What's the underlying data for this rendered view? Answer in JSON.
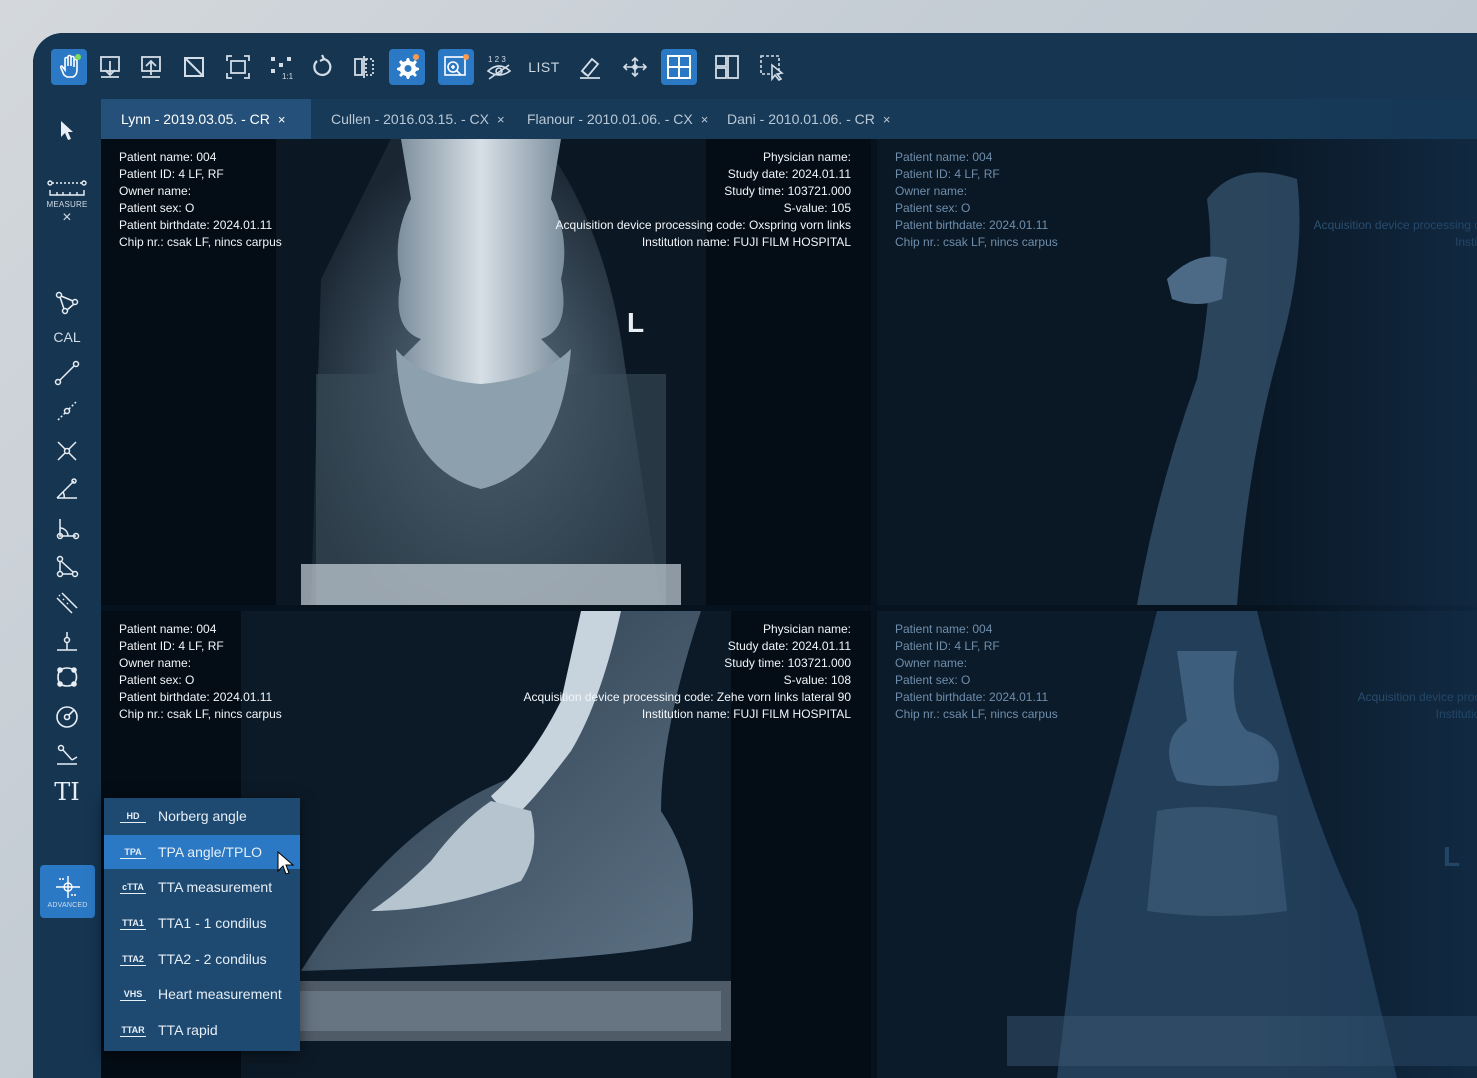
{
  "toolbar": {
    "buttons": [
      {
        "name": "hand-pan-icon",
        "active": true
      },
      {
        "name": "import-series-icon",
        "active": false
      },
      {
        "name": "export-series-icon",
        "active": false
      },
      {
        "name": "crop-icon",
        "active": false
      },
      {
        "name": "fit-to-screen-icon",
        "active": false
      },
      {
        "name": "actual-size-icon",
        "active": false
      },
      {
        "name": "rotate-icon",
        "active": false
      },
      {
        "name": "flip-icon",
        "active": false
      },
      {
        "name": "settings-gear-icon",
        "active": true
      },
      {
        "name": "zoom-series-icon",
        "active": true
      },
      {
        "name": "hide-numbers-icon",
        "active": false
      },
      {
        "name": "list-view",
        "active": false
      },
      {
        "name": "eraser-icon",
        "active": false
      },
      {
        "name": "move-arrows-icon",
        "active": false
      },
      {
        "name": "grid-layout-icon",
        "active": true
      },
      {
        "name": "layout-split-icon",
        "active": false
      },
      {
        "name": "select-region-icon",
        "active": false
      }
    ],
    "list_label": "LIST",
    "numbers_label": "1 2 3",
    "one_to_one_label": "1:1"
  },
  "sidebar": {
    "measure_label": "MEASURE",
    "measure_close": "×",
    "cal_label": "CAL",
    "text_tool_label": "TI",
    "advanced_label": "ADVANCED"
  },
  "tabs": [
    {
      "label": "Lynn -  2019.03.05. - CR",
      "close": "×",
      "active": true
    },
    {
      "label": "Cullen -  2016.03.15. - CX",
      "close": "×",
      "active": false
    },
    {
      "label": "Flanour -  2010.01.06. - CX",
      "close": "×",
      "active": false
    },
    {
      "label": "Dani -  2010.01.06. - CR",
      "close": "×",
      "active": false
    }
  ],
  "panes": [
    {
      "left": [
        "Patient name: 004",
        "Patient ID: 4 LF, RF",
        "Owner name:",
        "Patient sex: O",
        "Patient birthdate: 2024.01.11",
        "Chip nr.: csak LF, nincs carpus"
      ],
      "right": [
        "Physician name:",
        "Study date: 2024.01.11",
        "Study time: 103721.000",
        "S-value: 105",
        "Acquisition device processing code: Oxspring vorn links",
        "Institution name: FUJI FILM HOSPITAL"
      ],
      "marker": "L"
    },
    {
      "left": [
        "Patient name: 004",
        "Patient ID: 4 LF, RF",
        "Owner name:",
        "Patient sex: O",
        "Patient birthdate: 2024.01.11",
        "Chip nr.: csak LF, nincs carpus"
      ],
      "right": [
        "Acquisition device processing co",
        "Institu"
      ],
      "marker": ""
    },
    {
      "left": [
        "Patient name: 004",
        "Patient ID: 4 LF, RF",
        "Owner name:",
        "Patient sex: O",
        "Patient birthdate: 2024.01.11",
        "Chip nr.: csak LF, nincs carpus"
      ],
      "right": [
        "Physician name:",
        "Study date: 2024.01.11",
        "Study time: 103721.000",
        "S-value: 108",
        "Acquisition device processing code: Zehe vorn links lateral 90",
        "Institution name: FUJI FILM HOSPITAL"
      ],
      "marker": ""
    },
    {
      "left": [
        "Patient name: 004",
        "Patient ID: 4 LF, RF",
        "Owner name:",
        "Patient sex: O",
        "Patient birthdate: 2024.01.11",
        "Chip nr.: csak LF, nincs carpus"
      ],
      "right": [
        "Acquisition device proce",
        "Institution"
      ],
      "marker": "L"
    }
  ],
  "advanced_menu": {
    "items": [
      {
        "code": "HD",
        "label": "Norberg angle",
        "highlighted": false
      },
      {
        "code": "TPA",
        "label": "TPA angle/TPLO",
        "highlighted": true
      },
      {
        "code": "cTTA",
        "label": "TTA measurement",
        "highlighted": false
      },
      {
        "code": "TTA1",
        "label": "TTA1 - 1 condilus",
        "highlighted": false
      },
      {
        "code": "TTA2",
        "label": "TTA2 - 2 condilus",
        "highlighted": false
      },
      {
        "code": "VHS",
        "label": "Heart measurement",
        "highlighted": false
      },
      {
        "code": "TTAR",
        "label": "TTA rapid",
        "highlighted": false
      }
    ]
  },
  "colors": {
    "accent": "#2b78c4",
    "chrome": "#163551",
    "tab_active": "#24507a",
    "viewer_bg": "#040c15"
  }
}
